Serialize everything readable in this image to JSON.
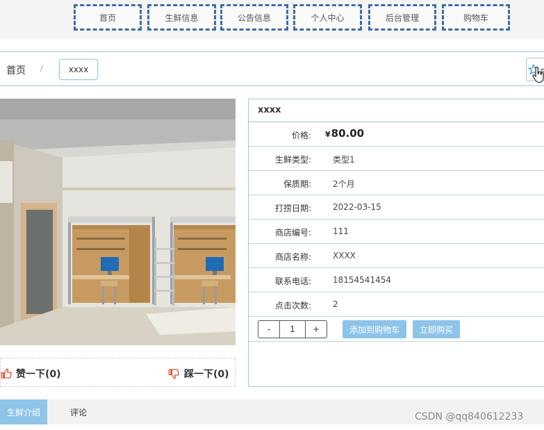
{
  "nav": {
    "items": [
      "首页",
      "生鲜信息",
      "公告信息",
      "个人中心",
      "后台管理",
      "购物车"
    ]
  },
  "breadcrumb": {
    "home": "首页",
    "separator": "/",
    "current": "xxxx"
  },
  "favorite": {
    "label": "点",
    "icon": "star-icon"
  },
  "product": {
    "title": "xxxx",
    "price_label": "价格:",
    "currency": "¥",
    "price": "80.00",
    "fields": [
      {
        "label": "生鲜类型:",
        "value": "类型1"
      },
      {
        "label": "保质期:",
        "value": "2个月"
      },
      {
        "label": "打捞日期:",
        "value": "2022-03-15"
      },
      {
        "label": "商店编号:",
        "value": "111"
      },
      {
        "label": "商店名称:",
        "value": "XXXX"
      },
      {
        "label": "联系电话:",
        "value": "18154541454"
      },
      {
        "label": "点击次数:",
        "value": "2"
      }
    ],
    "quantity": "1",
    "minus": "-",
    "plus": "+",
    "add_to_cart": "添加到购物车",
    "buy_now": "立即购买"
  },
  "votes": {
    "like_label": "赞一下(0)",
    "dislike_label": "踩一下(0)"
  },
  "tabs": {
    "active": "生鲜介绍",
    "other": "评论"
  },
  "watermark": "CSDN @qq840612233",
  "colors": {
    "accent": "#8ec4e8",
    "border": "#9cc8e2",
    "nav_border": "#3e6da6",
    "thumb": "#e04a3a"
  }
}
